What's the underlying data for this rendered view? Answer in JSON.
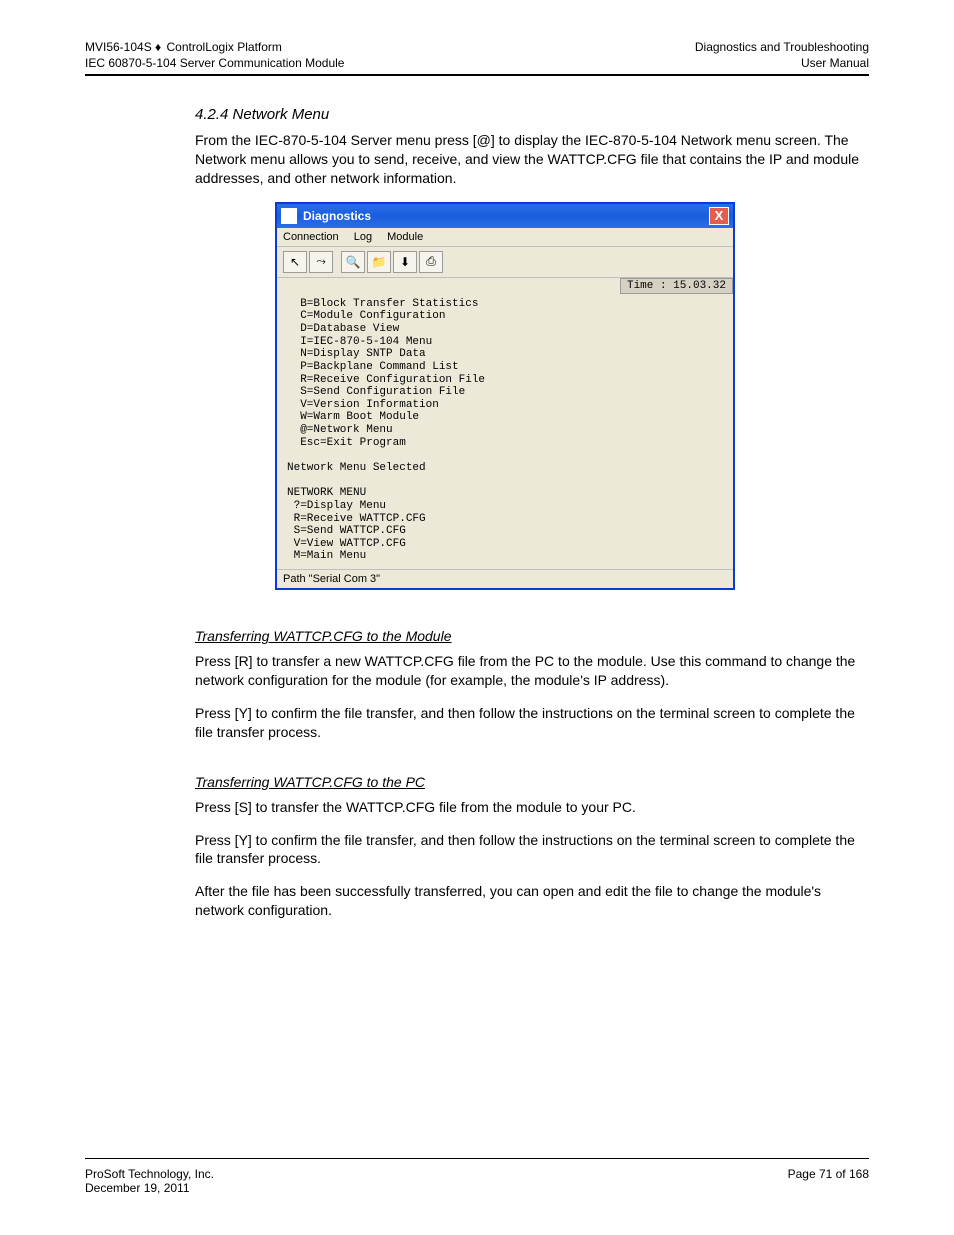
{
  "header": {
    "left_line1_prefix": "MVI56-104S",
    "left_line1_bullet": "♦",
    "left_line1_suffix": "ControlLogix Platform",
    "right_line1": "Diagnostics and Troubleshooting",
    "left_line2": "IEC 60870-5-104 Server Communication Module",
    "right_line2": "User Manual"
  },
  "sections": {
    "network_menu": {
      "title": "4.2.4  Network Menu",
      "para": "From the IEC-870-5-104 Server menu press [@] to display the IEC-870-5-104 Network menu screen. The Network menu allows you to send, receive, and view the WATTCP.CFG file that contains the IP and module addresses, and other network information."
    },
    "transferring": {
      "heading": "Transferring WATTCP.CFG to the Module",
      "p1": "Press [R] to transfer a new WATTCP.CFG file from the PC to the module. Use this command to change the network configuration for the module (for example, the module's IP address).",
      "p2": "Press [Y] to confirm the file transfer, and then follow the instructions on the terminal screen to complete the file transfer process."
    },
    "transferring_pc": {
      "heading": "Transferring WATTCP.CFG to the PC",
      "p1": "Press [S] to transfer the WATTCP.CFG file from the module to your PC.",
      "p2": "Press [Y] to confirm the file transfer, and then follow the instructions on the terminal screen to complete the file transfer process.",
      "p3": "After the file has been successfully transferred, you can open and edit the file to change the module's network configuration."
    }
  },
  "window": {
    "title": "Diagnostics",
    "close": "X",
    "menus": [
      "Connection",
      "Log",
      "Module"
    ],
    "toolbar_icons": [
      "pointer-icon",
      "connect-icon",
      "zoom-icon",
      "folder-icon",
      "download-icon",
      "print-icon"
    ],
    "time_label": "Time : 15.03.32",
    "terminal_main": "  B=Block Transfer Statistics\n  C=Module Configuration\n  D=Database View\n  I=IEC-870-5-104 Menu\n  N=Display SNTP Data\n  P=Backplane Command List\n  R=Receive Configuration File\n  S=Send Configuration File\n  V=Version Information\n  W=Warm Boot Module\n  @=Network Menu\n  Esc=Exit Program\n\nNetwork Menu Selected\n\nNETWORK MENU\n ?=Display Menu\n R=Receive WATTCP.CFG\n S=Send WATTCP.CFG\n V=View WATTCP.CFG\n M=Main Menu",
    "status": "Path \"Serial Com 3\""
  },
  "footer": {
    "left_line1": "ProSoft Technology, Inc.",
    "right_line1": "Page 71 of 168",
    "left_line2": "December 19, 2011"
  }
}
